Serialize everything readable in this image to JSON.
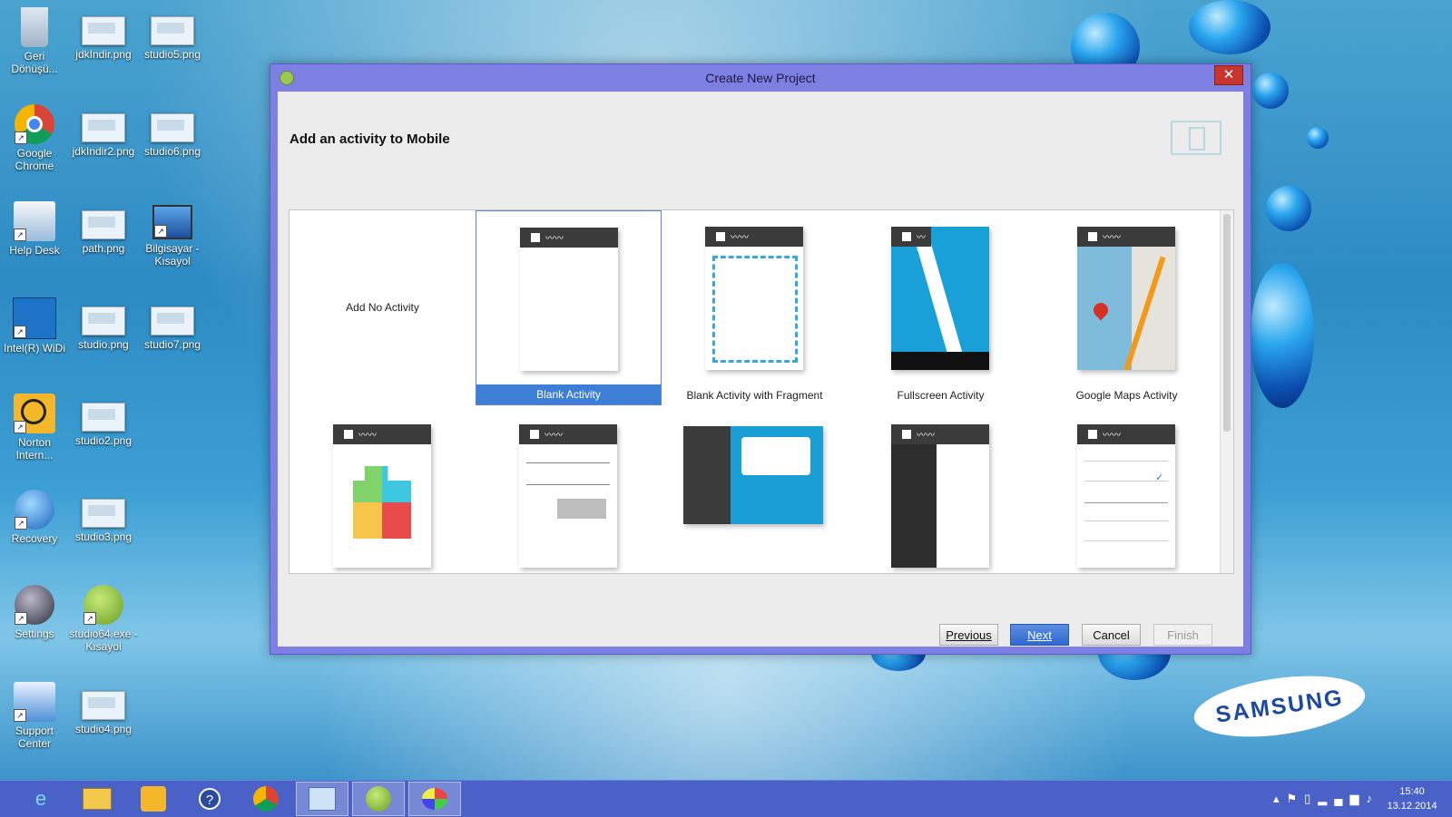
{
  "desktop": {
    "icons": [
      {
        "label": "Geri Dönüşü...",
        "icon": "recycle-bin-icon"
      },
      {
        "label": "jdkIndir.png",
        "icon": "image-file-icon"
      },
      {
        "label": "studio5.png",
        "icon": "image-file-icon"
      },
      {
        "label": "Google Chrome",
        "icon": "chrome-icon"
      },
      {
        "label": "jdkIndir2.png",
        "icon": "image-file-icon"
      },
      {
        "label": "studio6.png",
        "icon": "image-file-icon"
      },
      {
        "label": "Help Desk",
        "icon": "help-desk-icon"
      },
      {
        "label": "path.png",
        "icon": "image-file-icon"
      },
      {
        "label": "Bilgisayar - Kısayol",
        "icon": "computer-icon"
      },
      {
        "label": "Intel(R) WiDi",
        "icon": "widi-icon"
      },
      {
        "label": "studio.png",
        "icon": "image-file-icon"
      },
      {
        "label": "studio7.png",
        "icon": "image-file-icon"
      },
      {
        "label": "Norton Intern...",
        "icon": "norton-icon"
      },
      {
        "label": "studio2.png",
        "icon": "image-file-icon"
      },
      {
        "label": "Recovery",
        "icon": "recovery-icon"
      },
      {
        "label": "studio3.png",
        "icon": "image-file-icon"
      },
      {
        "label": "Settings",
        "icon": "settings-icon"
      },
      {
        "label": "studio64.exe - Kısayol",
        "icon": "android-studio-icon"
      },
      {
        "label": "Support Center",
        "icon": "support-center-icon"
      },
      {
        "label": "studio4.png",
        "icon": "image-file-icon"
      }
    ],
    "brand": "SAMSUNG"
  },
  "dialog": {
    "title": "Create New Project",
    "close_glyph": "✕",
    "heading": "Add an activity to Mobile",
    "templates": [
      {
        "label": "Add No Activity",
        "selected": false
      },
      {
        "label": "Blank Activity",
        "selected": true
      },
      {
        "label": "Blank Activity with Fragment",
        "selected": false
      },
      {
        "label": "Fullscreen Activity",
        "selected": false
      },
      {
        "label": "Google Maps Activity",
        "selected": false
      },
      {
        "label": "",
        "selected": false
      },
      {
        "label": "",
        "selected": false
      },
      {
        "label": "",
        "selected": false
      },
      {
        "label": "",
        "selected": false
      },
      {
        "label": "",
        "selected": false
      }
    ],
    "buttons": {
      "previous": "Previous",
      "next": "Next",
      "cancel": "Cancel",
      "finish": "Finish"
    }
  },
  "taskbar": {
    "items": [
      "internet-explorer-icon",
      "file-explorer-icon",
      "norton-icon",
      "help-icon",
      "chrome-icon",
      "control-panel-icon",
      "android-studio-icon",
      "paint-icon"
    ],
    "active_item": "android-studio-icon",
    "clock_time": "15:40",
    "clock_date": "13.12.2014"
  },
  "colors": {
    "dialog_frame": "#7d7fe3",
    "selection": "#3d7ed6",
    "close_button": "#c7372f",
    "taskbar": "#4a62c8"
  }
}
